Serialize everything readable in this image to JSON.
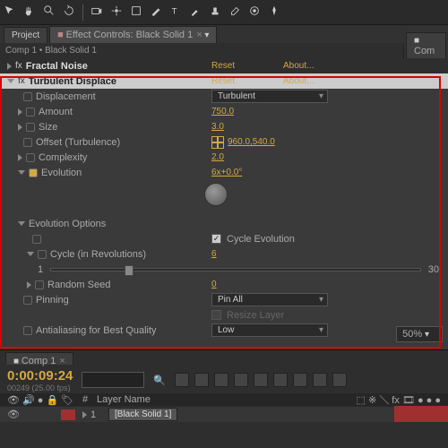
{
  "tabs": {
    "project": "Project",
    "effects": "Effect Controls: Black Solid 1",
    "comp": "Com"
  },
  "crumb": "Comp 1 • Black Solid 1",
  "fx1": {
    "name": "Fractal Noise",
    "reset": "Reset",
    "about": "About..."
  },
  "fx2": {
    "name": "Turbulent Displace",
    "reset": "Reset",
    "about": "About..."
  },
  "p": {
    "disp": "Displacement",
    "dispv": "Turbulent",
    "amt": "Amount",
    "amtv": "750.0",
    "size": "Size",
    "sizev": "3.0",
    "off": "Offset (Turbulence)",
    "offv": "960.0,540.0",
    "comp": "Complexity",
    "compv": "2.0",
    "evo": "Evolution",
    "evov": "6x+0.0°",
    "eopts": "Evolution Options",
    "cycevo": "Cycle Evolution",
    "cycle": "Cycle (in Revolutions)",
    "cyclev": "6",
    "c1": "1",
    "c2": "30",
    "rseed": "Random Seed",
    "rseedv": "0",
    "pin": "Pinning",
    "pinv": "Pin All",
    "resize": "Resize Layer",
    "aa": "Antialiasing for Best Quality",
    "aav": "Low"
  },
  "tl": {
    "tab": "Comp 1",
    "tc": "0:00:09:24",
    "sub": "00249 (25.00 fps)",
    "srch": "",
    "colnum": "#",
    "colname": "Layer Name",
    "num": "1",
    "layer": "[Black Solid 1]",
    "comptab": "Comp 1"
  },
  "zoom": "50%"
}
